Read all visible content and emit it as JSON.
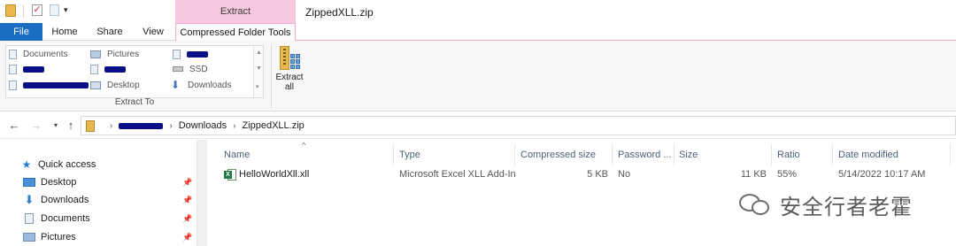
{
  "window": {
    "title": "ZippedXLL.zip",
    "context_tab_group": "Extract"
  },
  "ribbon": {
    "tabs": [
      {
        "label": "File"
      },
      {
        "label": "Home"
      },
      {
        "label": "Share"
      },
      {
        "label": "View"
      },
      {
        "label": "Compressed Folder Tools"
      }
    ],
    "gallery": {
      "items": [
        {
          "label": "Documents"
        },
        {
          "label": "Pictures"
        },
        {
          "label": "SSD"
        },
        {
          "label": "Desktop"
        },
        {
          "label": "Downloads"
        }
      ],
      "group_label": "Extract To"
    },
    "extract_all": {
      "line1": "Extract",
      "line2": "all"
    }
  },
  "address": {
    "crumbs": [
      "Downloads",
      "ZippedXLL.zip"
    ]
  },
  "nav_pane": {
    "items": [
      {
        "label": "Quick access"
      },
      {
        "label": "Desktop"
      },
      {
        "label": "Downloads"
      },
      {
        "label": "Documents"
      },
      {
        "label": "Pictures"
      }
    ]
  },
  "file_list": {
    "columns": [
      "Name",
      "Type",
      "Compressed size",
      "Password ...",
      "Size",
      "Ratio",
      "Date modified"
    ],
    "rows": [
      {
        "name": "HelloWorldXll.xll",
        "type": "Microsoft Excel XLL Add-In",
        "compressed_size": "5 KB",
        "password": "No",
        "size": "11 KB",
        "ratio": "55%",
        "date_modified": "5/14/2022 10:17 AM"
      }
    ]
  },
  "watermark": {
    "text": "安全行者老霍"
  },
  "colors": {
    "file_tab": "#1a6ec1",
    "context_tab": "#f7c7df",
    "redaction": "#0b0f86"
  }
}
